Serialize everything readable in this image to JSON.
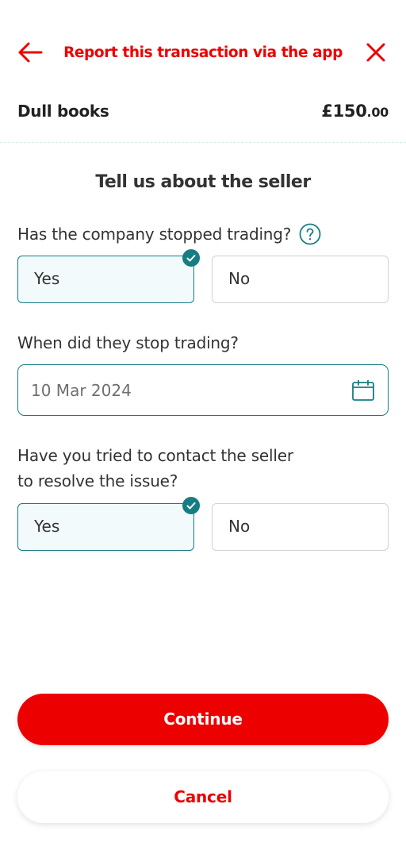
{
  "colors": {
    "brand_red": "#ec0000",
    "accent_teal": "#167d83",
    "selected_bg": "#f2fafb",
    "text_dark": "#333333"
  },
  "header": {
    "back_icon": "arrow-left-icon",
    "title": "Report this transaction via the app",
    "close_icon": "close-icon"
  },
  "transaction": {
    "name": "Dull books",
    "amount_major": "£150",
    "amount_minor": ".00"
  },
  "section_title": "Tell us about the seller",
  "questions": [
    {
      "label": "Has the company stopped trading?",
      "help_icon": "question-circle-icon",
      "options": [
        {
          "label": "Yes",
          "selected": true
        },
        {
          "label": "No",
          "selected": false
        }
      ]
    },
    {
      "label": "When did they stop trading?",
      "value": "10 Mar 2024",
      "icon": "calendar-icon"
    },
    {
      "label_line1": "Have you tried to contact the seller",
      "label_line2": "to resolve the issue?",
      "options": [
        {
          "label": "Yes",
          "selected": true
        },
        {
          "label": "No",
          "selected": false
        }
      ]
    }
  ],
  "buttons": {
    "continue": "Continue",
    "cancel": "Cancel"
  }
}
